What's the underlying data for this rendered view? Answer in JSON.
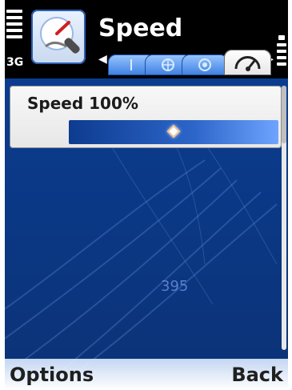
{
  "status": {
    "network": "3G"
  },
  "header": {
    "title": "Speed"
  },
  "tabs": {
    "items": [
      "tab-1",
      "tab-2",
      "tab-3",
      "tab-speedometer"
    ],
    "active_index": 3
  },
  "setting": {
    "label": "Speed 100%",
    "value_percent": 100
  },
  "map": {
    "road_label": "395"
  },
  "softkeys": {
    "left": "Options",
    "right": "Back"
  },
  "icons": {
    "signal": "signal-bars-icon",
    "battery": "battery-bars-icon",
    "app": "speed-app-icon",
    "tab_wrench": "wrench-icon",
    "tab_globe": "globe-icon",
    "tab_target": "target-icon",
    "tab_speed": "speedometer-icon",
    "nav_left": "chevron-left-icon",
    "nav_right": "chevron-right-icon"
  },
  "colors": {
    "title_bg": "#000000",
    "map_bg": "#0c3f93",
    "card_bg": "#f0f0f0",
    "slider_start": "#0d3b8f",
    "slider_end": "#6ea4ff",
    "softkey_bg": "#ffffff"
  }
}
